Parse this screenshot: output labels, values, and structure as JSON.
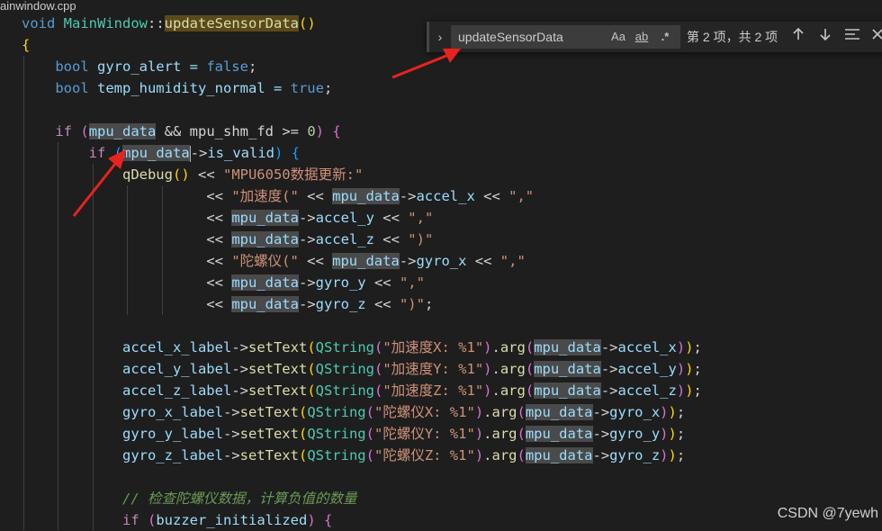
{
  "window": {
    "file_title": "ainwindow.cpp"
  },
  "find_widget": {
    "search_value": "updateSensorData",
    "match_case_label": "Aa",
    "whole_word_label": "ab",
    "regex_label": ".*",
    "result_text": "第 2 项，共 2 项",
    "toggle_replace_icon": "chevron-right-icon",
    "prev_icon": "arrow-up-icon",
    "next_icon": "arrow-down-icon",
    "selection_icon": "find-in-selection-icon",
    "close_icon": "close-icon"
  },
  "code": {
    "l1_void": "void",
    "l1_class": "MainWindow",
    "l1_scope": "::",
    "l1_func": "updateSensorData",
    "l1_paren": "()",
    "l2_brace": "{",
    "l3_type": "bool",
    "l3_rest": " gyro_alert = ",
    "l3_val": "false",
    "l3_end": ";",
    "l4_type": "bool",
    "l4_rest": " temp_humidity_normal = ",
    "l4_val": "true",
    "l4_end": ";",
    "l6_if": "if",
    "l6_open": "(",
    "l6_var": "mpu_data",
    "l6_mid": " && mpu_shm_fd >= ",
    "l6_zero": "0",
    "l6_close": ")",
    "l6_brace": "{",
    "l7_if": "if",
    "l7_open": "(",
    "l7_var": "mpu_data",
    "l7_arrow": "->",
    "l7_member": "is_valid",
    "l7_close": ")",
    "l7_brace": "{",
    "l8_func": "qDebug",
    "l8_paren": "()",
    "l8_op": " << ",
    "l8_str": "\"MPU6050数据更新:\"",
    "l9_op": "<< ",
    "l9_str": "\"加速度(\"",
    "l9_op2": " << ",
    "l9_var": "mpu_data",
    "l9_arrow": "->",
    "l9_member": "accel_x",
    "l9_op3": " << ",
    "l9_str2": "\",\"",
    "l10_op": "<< ",
    "l10_var": "mpu_data",
    "l10_arrow": "->",
    "l10_member": "accel_y",
    "l10_op2": " << ",
    "l10_str": "\",\"",
    "l11_op": "<< ",
    "l11_var": "mpu_data",
    "l11_arrow": "->",
    "l11_member": "accel_z",
    "l11_op2": " << ",
    "l11_str": "\")\"",
    "l12_op": "<< ",
    "l12_str": "\"陀螺仪(\"",
    "l12_op2": " << ",
    "l12_var": "mpu_data",
    "l12_arrow": "->",
    "l12_member": "gyro_x",
    "l12_op3": " << ",
    "l12_str2": "\",\"",
    "l13_op": "<< ",
    "l13_var": "mpu_data",
    "l13_arrow": "->",
    "l13_member": "gyro_y",
    "l13_op2": " << ",
    "l13_str": "\",\"",
    "l14_op": "<< ",
    "l14_var": "mpu_data",
    "l14_arrow": "->",
    "l14_member": "gyro_z",
    "l14_op2": " << ",
    "l14_str": "\")\"",
    "l14_end": ";",
    "set_lines": [
      {
        "obj": "accel_x_label",
        "str": "\"加速度X: %1\"",
        "member": "accel_x"
      },
      {
        "obj": "accel_y_label",
        "str": "\"加速度Y: %1\"",
        "member": "accel_y"
      },
      {
        "obj": "accel_z_label",
        "str": "\"加速度Z: %1\"",
        "member": "accel_z"
      },
      {
        "obj": "gyro_x_label",
        "str": "\"陀螺仪X: %1\"",
        "member": "gyro_x"
      },
      {
        "obj": "gyro_y_label",
        "str": "\"陀螺仪Y: %1\"",
        "member": "gyro_y"
      },
      {
        "obj": "gyro_z_label",
        "str": "\"陀螺仪Z: %1\"",
        "member": "gyro_z"
      }
    ],
    "tok_arrow": "->",
    "tok_settext": "setText",
    "tok_qstring": "QString",
    "tok_arg": "arg",
    "tok_var": "mpu_data",
    "tok_open": "(",
    "tok_close": ")",
    "tok_dot": ".",
    "tok_end": ";",
    "l23_comment": "// 检查陀螺仪数据，计算负值的数量",
    "l24_if": "if",
    "l24_open": "(",
    "l24_var": "buzzer_initialized",
    "l24_close": ")",
    "l24_brace": "{"
  },
  "watermark": "CSDN @7yewh",
  "colors": {
    "arrow": "#e8231f",
    "background": "#1e1e1e"
  }
}
